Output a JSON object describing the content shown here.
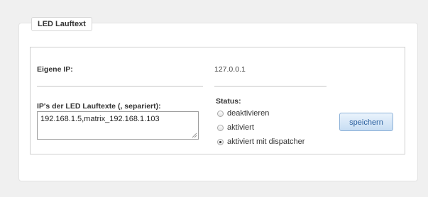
{
  "panel": {
    "title": "LED Lauftext"
  },
  "own_ip": {
    "label": "Eigene IP:",
    "value": "127.0.0.1"
  },
  "led_ips": {
    "label": "IP's der LED Lauftexte (, separiert):",
    "value": "192.168.1.5,matrix_192.168.1.103"
  },
  "status": {
    "label": "Status:",
    "options": [
      {
        "label": "deaktivieren",
        "checked": false
      },
      {
        "label": "aktiviert",
        "checked": false
      },
      {
        "label": "aktiviert mit dispatcher",
        "checked": true
      }
    ]
  },
  "save_button": {
    "label": "speichern"
  },
  "colors": {
    "button_text": "#2a5f9e",
    "button_border": "#8fb3d9"
  }
}
